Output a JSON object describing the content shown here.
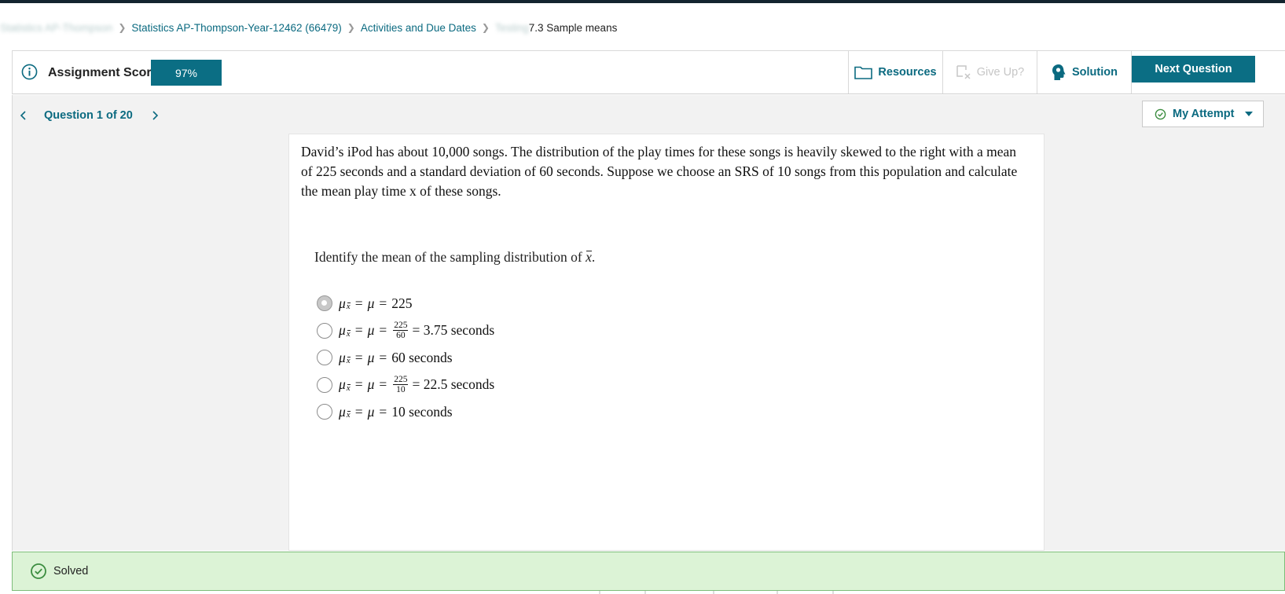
{
  "breadcrumb": {
    "root": "Statistics AP-Thompson",
    "course": "Statistics AP-Thompson-Year-12462 (66479)",
    "section": "Activities and Due Dates",
    "current_prefix": "Testing",
    "current": "7.3 Sample means"
  },
  "header": {
    "score_label": "Assignment Score:",
    "score_value": "97%",
    "resources_label": "Resources",
    "giveup_label": "Give Up?",
    "solution_label": "Solution",
    "next_label": "Next Question"
  },
  "question_nav": {
    "label": "Question 1 of 20",
    "attempt_label": "My Attempt"
  },
  "question": {
    "stem": "David’s iPod has about 10,000 songs. The distribution of the play times for these songs is heavily skewed to the right with a mean of 225 seconds and a standard deviation of 60 seconds. Suppose we choose an SRS of 10 songs from this population and calculate the mean play time x of these songs.",
    "prompt_text": "Identify the mean of the sampling distribution of",
    "prompt_var": "x",
    "prompt_end": ".",
    "selected_index": 0,
    "options": [
      {
        "mu": "μ",
        "sub": "x",
        "eq": "=",
        "mu2": "μ",
        "eq2": "=",
        "value": "225",
        "frac_num": "",
        "frac_den": "",
        "after": ""
      },
      {
        "mu": "μ",
        "sub": "x",
        "eq": "=",
        "mu2": "μ",
        "eq2": "=",
        "value": "",
        "frac_num": "225",
        "frac_den": "60",
        "after": "= 3.75 seconds"
      },
      {
        "mu": "μ",
        "sub": "x",
        "eq": "=",
        "mu2": "μ",
        "eq2": "=",
        "value": "60 seconds",
        "frac_num": "",
        "frac_den": "",
        "after": ""
      },
      {
        "mu": "μ",
        "sub": "x",
        "eq": "=",
        "mu2": "μ",
        "eq2": "=",
        "value": "",
        "frac_num": "225",
        "frac_den": "10",
        "after": "= 22.5 seconds"
      },
      {
        "mu": "μ",
        "sub": "x",
        "eq": "=",
        "mu2": "μ",
        "eq2": "=",
        "value": "10 seconds",
        "frac_num": "",
        "frac_den": "",
        "after": ""
      }
    ]
  },
  "status": {
    "label": "Solved"
  },
  "icons": {
    "info": "info-icon",
    "folder": "folder-icon",
    "giveup": "give-up-icon",
    "solution": "lightbulb-head-icon",
    "check": "check-circle-icon",
    "caret": "caret-down-icon",
    "prev": "chevron-left-icon",
    "next": "chevron-right-icon"
  },
  "colors": {
    "brand": "#0b6e84",
    "link": "#0b6a80",
    "solved_bg": "#dcf3d6",
    "solved_border": "#7dbd7a",
    "success": "#3c8d40"
  }
}
